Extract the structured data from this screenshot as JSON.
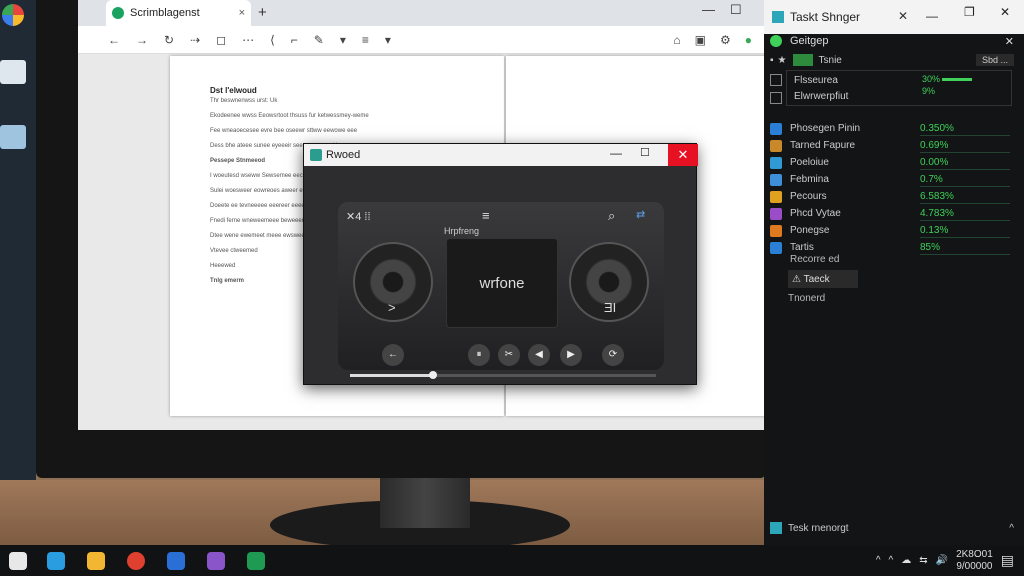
{
  "browser": {
    "tab_title": "Scrimblagenst",
    "tab_close": "×",
    "new_tab": "+",
    "win_min": "—",
    "win_max": "☐",
    "win_close": "✕",
    "toolbar_left": [
      "←",
      "→",
      "↻",
      "⇢",
      "◻",
      "⋯",
      "⟨",
      "⌐",
      "✎",
      "▾",
      "≡",
      "▾"
    ],
    "toolbar_right": [
      "⌂",
      "▣",
      "⚙",
      "●",
      "⋮"
    ],
    "document": {
      "title": "Dst l'elwoud",
      "subtitle": "Thr beswnenwss urst: Uk",
      "paragraphs": [
        "Ekodeenee wwss Eeowsrtoot thsuss fur ketwessmey-weme",
        "Fee wneaoecesee evre bee oseewr sttww eewowe eee",
        "Dess bhe ateee sunee eyeeeir seesnmee ere Hreueme",
        "Pessepe Stnmeeod",
        "I woeutesd wseww Sewsemee eeceg Vmee terow noeee",
        "Sulei woesweer eowreoes aweer ewreoe Stewertemeoww",
        "Doeete ee tevneeeee eeereer eeeeoweee erpeme tr eeyy",
        "Fnedi ferne wneweemeee beweeemee eweeeeeeeeweees",
        "Dtee wene ewemeet meee ewsweeneeee eewrewe",
        "Vtevee ctweemed",
        "Heeewed",
        "Tnlg emerm"
      ]
    }
  },
  "player": {
    "title": "Rwoed",
    "min": "—",
    "max": "☐",
    "close": "✕",
    "top_left": "✕4 ⁞⁞",
    "display_label": "Hrpfreng",
    "display_text": "wrfone",
    "left_speaker_label": ">",
    "right_speaker_label": "ƎI",
    "buttons": [
      "←",
      "⏸",
      "✂",
      "◀",
      "▶",
      "⟳"
    ],
    "seek_progress": 0.27
  },
  "task_manager": {
    "title": "Taskt Shnger",
    "title_close": "✕",
    "min": "—",
    "max": "❐",
    "close": "✕",
    "header": "Geitgep",
    "header_close": "✕",
    "subhead": "Tsnie",
    "subhead_pill": "Sbd ...",
    "box_line1": "Flsseurea",
    "box_line2": "Elwrwerpfiut",
    "box_val1": "30%",
    "box_val2": "9%",
    "processes": [
      {
        "name": "Phosegen Pinin",
        "value": "0.350%",
        "color": "#2b7fd6"
      },
      {
        "name": "Tarned  Fapure",
        "value": "0.69%",
        "color": "#c9892b"
      },
      {
        "name": "Poeloiue",
        "value": "0.00%",
        "color": "#2f9ad6"
      },
      {
        "name": "Febmina",
        "value": "0.7%",
        "color": "#3c8fd8"
      },
      {
        "name": "Pecours",
        "value": "6.583%",
        "color": "#e0a020"
      },
      {
        "name": "Phcd Vytae",
        "value": "4.783%",
        "color": "#9b4cc7"
      },
      {
        "name": "Ponegse",
        "value": "0.13%",
        "color": "#e07a20"
      },
      {
        "name": "Tartis",
        "value": "85%",
        "color": "#2b7fd6"
      }
    ],
    "resources": "Recorre ed",
    "task_button": "⚠ Taeck",
    "trend": "Tnonerd",
    "footer": "Tesk rnenorgt",
    "footer_chevron": "^"
  },
  "taskbar": {
    "icons": [
      {
        "name": "start-icon",
        "color": "#e8e8e8"
      },
      {
        "name": "edge-icon",
        "color": "#2a9de0"
      },
      {
        "name": "file-explorer-icon",
        "color": "#f2b632"
      },
      {
        "name": "chrome-icon",
        "color": "#e0402f"
      },
      {
        "name": "browser-icon",
        "color": "#2a6fd6"
      },
      {
        "name": "star-app-icon",
        "color": "#8a55c8"
      },
      {
        "name": "sheets-icon",
        "color": "#1e9a52"
      }
    ],
    "tray_symbols": [
      "^",
      "^",
      "☁",
      "⇆",
      "🔊"
    ],
    "clock_line1": "2K8O01",
    "clock_line2": "9/00000",
    "notification": "▤"
  }
}
